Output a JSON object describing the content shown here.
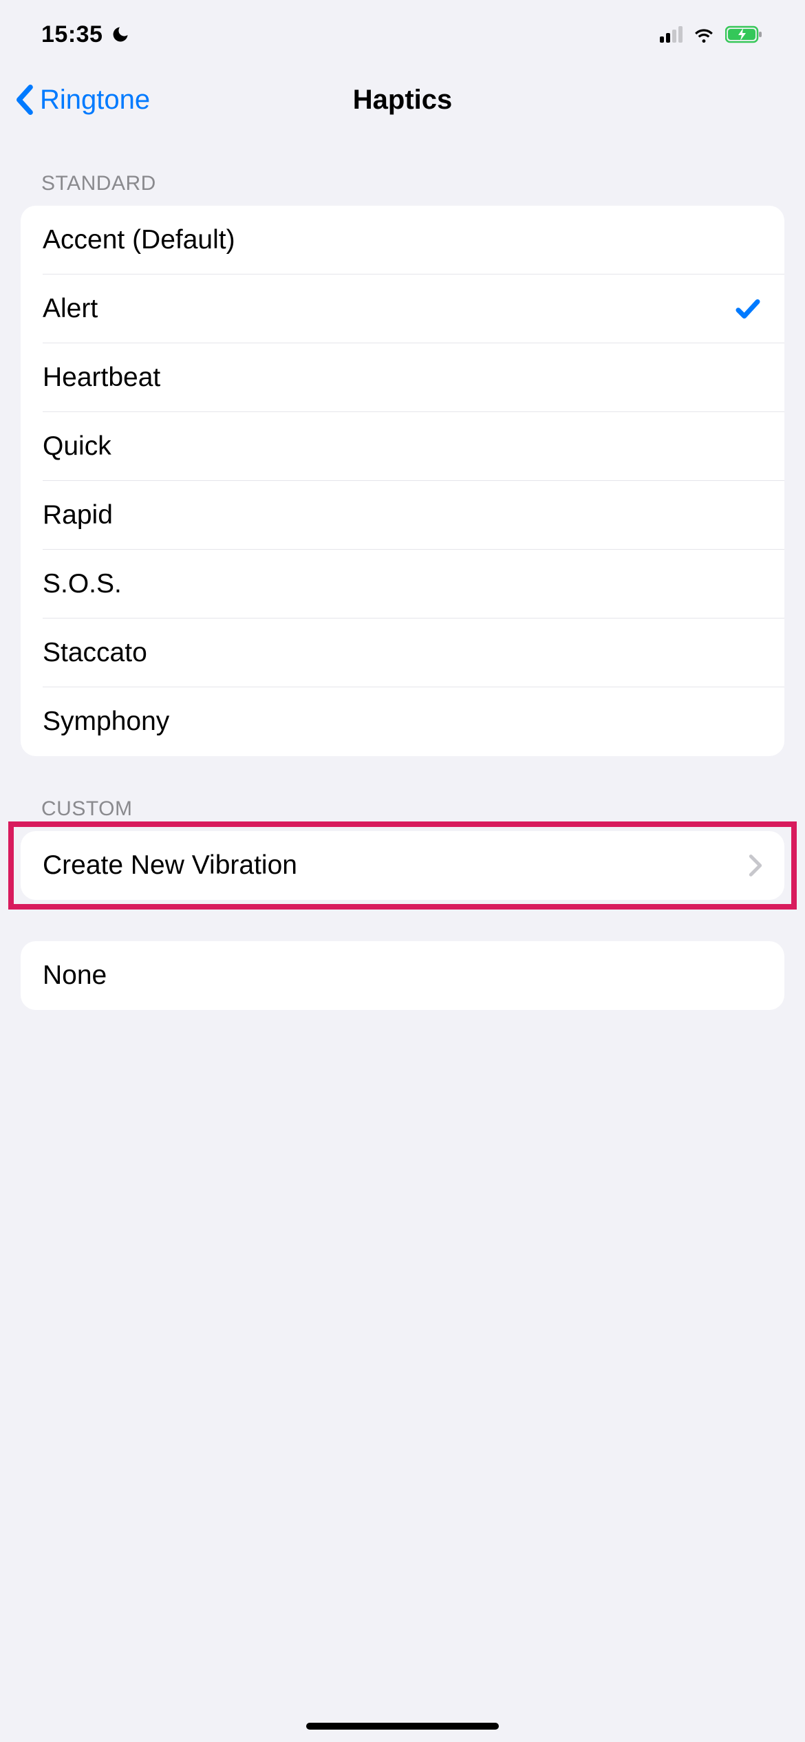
{
  "status": {
    "time": "15:35",
    "dnd": true
  },
  "nav": {
    "back_label": "Ringtone",
    "title": "Haptics"
  },
  "sections": {
    "standard": {
      "header": "Standard",
      "items": [
        {
          "label": "Accent (Default)",
          "selected": false
        },
        {
          "label": "Alert",
          "selected": true
        },
        {
          "label": "Heartbeat",
          "selected": false
        },
        {
          "label": "Quick",
          "selected": false
        },
        {
          "label": "Rapid",
          "selected": false
        },
        {
          "label": "S.O.S.",
          "selected": false
        },
        {
          "label": "Staccato",
          "selected": false
        },
        {
          "label": "Symphony",
          "selected": false
        }
      ]
    },
    "custom": {
      "header": "Custom",
      "items": [
        {
          "label": "Create New Vibration",
          "disclosure": true
        }
      ]
    },
    "none": {
      "items": [
        {
          "label": "None",
          "selected": false
        }
      ]
    }
  },
  "highlight": {
    "target": "create-new-vibration"
  }
}
